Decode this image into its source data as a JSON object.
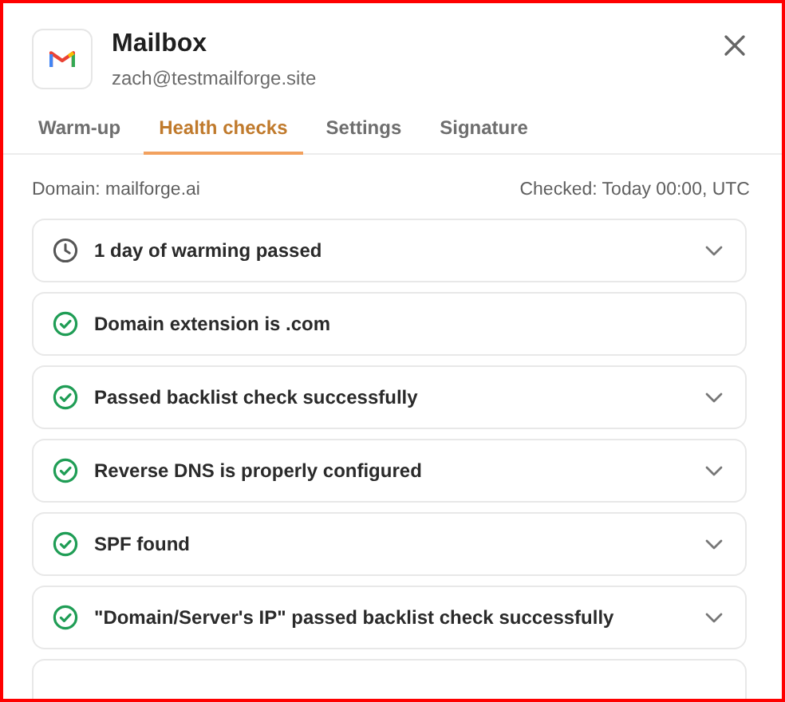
{
  "header": {
    "title": "Mailbox",
    "email": "zach@testmailforge.site"
  },
  "tabs": [
    {
      "label": "Warm-up",
      "selected": false
    },
    {
      "label": "Health checks",
      "selected": true
    },
    {
      "label": "Settings",
      "selected": false
    },
    {
      "label": "Signature",
      "selected": false
    }
  ],
  "info": {
    "domain": "Domain: mailforge.ai",
    "checked": "Checked: Today 00:00, UTC"
  },
  "checks": [
    {
      "kind": "pending",
      "label": "1 day of warming passed",
      "expandable": true
    },
    {
      "kind": "passed",
      "label": "Domain extension is .com",
      "expandable": false
    },
    {
      "kind": "passed",
      "label": "Passed backlist check successfully",
      "expandable": true
    },
    {
      "kind": "passed",
      "label": "Reverse DNS is properly configured",
      "expandable": true
    },
    {
      "kind": "passed",
      "label": "SPF found",
      "expandable": true
    },
    {
      "kind": "passed",
      "label": "\"Domain/Server's IP\" passed backlist check successfully",
      "expandable": true
    }
  ]
}
